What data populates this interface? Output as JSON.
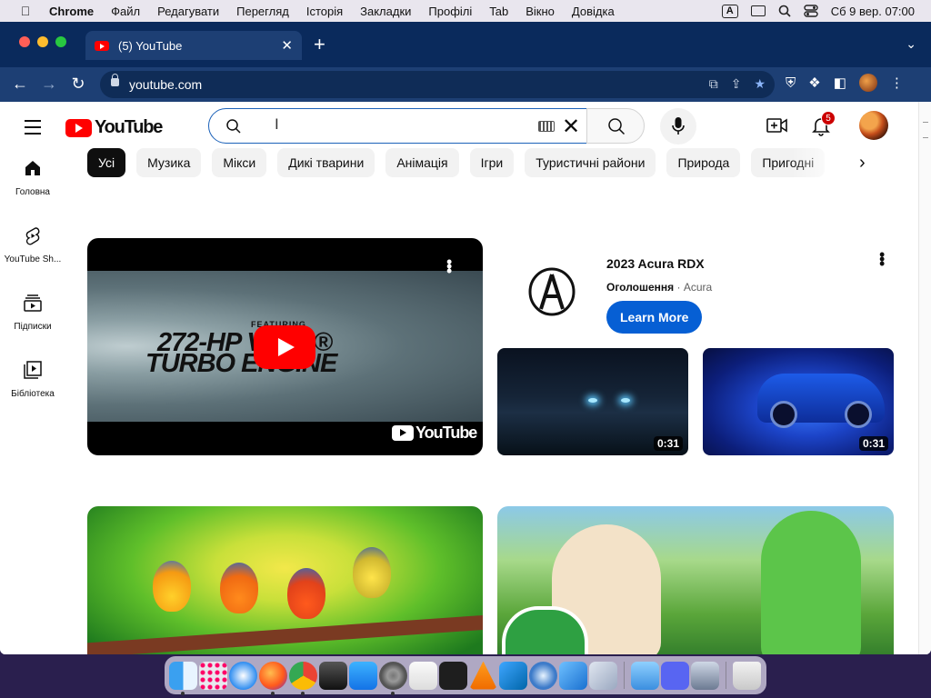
{
  "menubar": {
    "app": "Chrome",
    "items": [
      "Файл",
      "Редагувати",
      "Перегляд",
      "Історія",
      "Закладки",
      "Профілі",
      "Tab",
      "Вікно",
      "Довідка"
    ],
    "keyboard_indicator": "A",
    "clock": "Сб 9 вер.  07:00"
  },
  "browser": {
    "tab_title": "(5) YouTube",
    "url": "youtube.com",
    "traffic_colors": [
      "#ff5f57",
      "#febc2e",
      "#28c840"
    ]
  },
  "youtube": {
    "logo_text": "YouTube",
    "search": {
      "value": "",
      "placeholder": ""
    },
    "notification_count": "5",
    "nav": [
      {
        "label": "Головна",
        "icon": "home-icon"
      },
      {
        "label": "YouTube Sh...",
        "icon": "shorts-icon"
      },
      {
        "label": "Підписки",
        "icon": "subscriptions-icon"
      },
      {
        "label": "Бібліотека",
        "icon": "library-icon"
      }
    ],
    "chips": [
      "Усі",
      "Музика",
      "Мікси",
      "Дикі тварини",
      "Анімація",
      "Ігри",
      "Туристичні райони",
      "Природа",
      "Пригодні"
    ],
    "main_video": {
      "line_featuring": "FEATURING",
      "line1": "272-HP VTEC®",
      "line2": "TURBO ENGINE",
      "watermark": "YouTube"
    },
    "ad": {
      "title": "2023 Acura RDX",
      "label": "Оголошення",
      "advertiser": "Acura",
      "cta": "Learn More",
      "thumb_durations": [
        "0:31",
        "0:31"
      ]
    }
  },
  "colors": {
    "accent_blue": "#065fd4",
    "youtube_red": "#ff0000",
    "chrome_frame": "#0a2a5c"
  }
}
